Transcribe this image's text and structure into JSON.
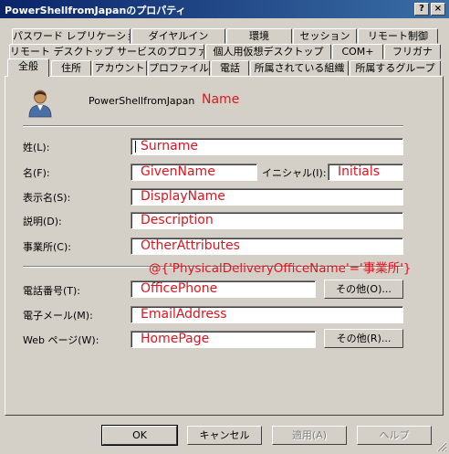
{
  "window": {
    "title": "PowerShellfromJapanのプロパティ",
    "help_glyph": "?",
    "close_glyph": "×"
  },
  "tabs": {
    "row1": [
      "パスワード レプリケーション",
      "ダイヤルイン",
      "環境",
      "セッション",
      "リモート制御"
    ],
    "row2": [
      "リモート デスクトップ サービスのプロファイル",
      "個人用仮想デスクトップ",
      "COM+",
      "フリガナ"
    ],
    "row3": [
      "全般",
      "住所",
      "アカウント",
      "プロファイル",
      "電話",
      "所属されている組織",
      "所属するグループ"
    ],
    "active": "全般"
  },
  "header": {
    "account_name": "PowerShellfromJapan",
    "name_annotation": "Name"
  },
  "form": {
    "surname_label": "姓(L):",
    "surname_value": "Surname",
    "givenname_label": "名(F):",
    "givenname_value": "GivenName",
    "initials_label": "イニシャル(I):",
    "initials_value": "Initials",
    "displayname_label": "表示名(S):",
    "displayname_value": "DisplayName",
    "description_label": "説明(D):",
    "description_value": "Description",
    "office_label": "事業所(C):",
    "office_value": "OtherAttributes",
    "office_note": "@{'PhysicalDeliveryOfficeName'='事業所'}",
    "phone_label": "電話番号(T):",
    "phone_value": "OfficePhone",
    "phone_other_button": "その他(O)...",
    "email_label": "電子メール(M):",
    "email_value": "EmailAddress",
    "webpage_label": "Web ページ(W):",
    "webpage_value": "HomePage",
    "webpage_other_button": "その他(R)..."
  },
  "footer": {
    "ok": "OK",
    "cancel": "キャンセル",
    "apply": "適用(A)",
    "help": "ヘルプ"
  },
  "colors": {
    "face": "#d4d0c8",
    "title_start": "#0a246a",
    "title_end": "#3a6ea5",
    "annotation": "#e0141e"
  }
}
